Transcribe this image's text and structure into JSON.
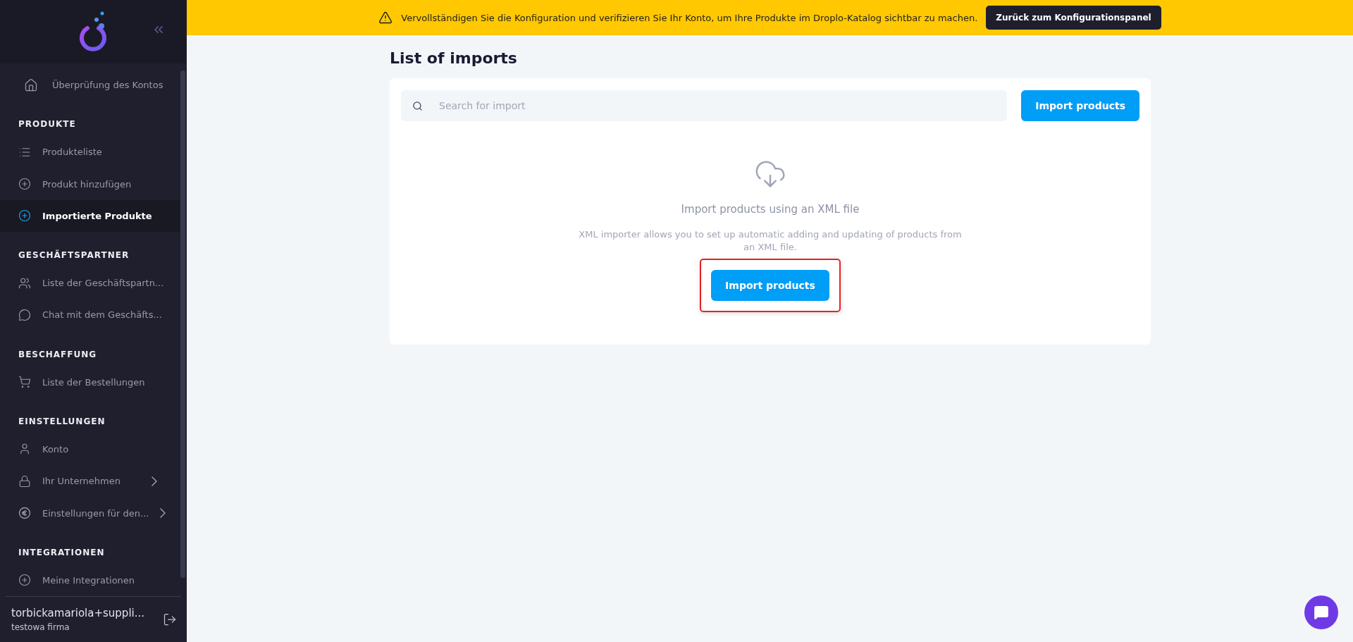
{
  "banner": {
    "message": "Vervollständigen Sie die Konfiguration und verifizieren Sie Ihr Konto, um Ihre Produkte im Droplo-Katalog sichtbar zu machen.",
    "button": "Zurück zum Konfigurationspanel"
  },
  "sidebar": {
    "top_item": {
      "label": "Überprüfung des Kontos",
      "selected": false
    },
    "sections": [
      {
        "title": "PRODUKTE",
        "items": [
          {
            "label": "Produkteliste",
            "selected": false,
            "submenu": false
          },
          {
            "label": "Produkt hinzufügen",
            "selected": false,
            "submenu": false
          },
          {
            "label": "Importierte Produkte",
            "selected": true,
            "submenu": false
          }
        ]
      },
      {
        "title": "GESCHÄFTSPARTNER",
        "items": [
          {
            "label": "Liste der Geschäftspartn...",
            "selected": false,
            "submenu": false
          },
          {
            "label": "Chat mit dem Geschäfts...",
            "selected": false,
            "submenu": false
          }
        ]
      },
      {
        "title": "BESCHAFFUNG",
        "items": [
          {
            "label": "Liste der Bestellungen",
            "selected": false,
            "submenu": false
          }
        ]
      },
      {
        "title": "EINSTELLUNGEN",
        "items": [
          {
            "label": "Konto",
            "selected": false,
            "submenu": false
          },
          {
            "label": "Ihr Unternehmen",
            "selected": false,
            "submenu": true
          },
          {
            "label": "Einstellungen für den...",
            "selected": false,
            "submenu": true
          }
        ]
      },
      {
        "title": "INTEGRATIONEN",
        "items": [
          {
            "label": "Meine Integrationen",
            "selected": false,
            "submenu": false
          }
        ]
      }
    ],
    "user": {
      "name": "torbickamariola+suppli...",
      "company": "testowa firma"
    }
  },
  "page": {
    "title": "List of imports",
    "search": {
      "placeholder": "Search for import"
    },
    "import_button": "Import products",
    "empty_state": {
      "heading": "Import products using an XML file",
      "description": "XML importer allows you to set up automatic adding and updating of products from an XML file.",
      "button": "Import products",
      "highlighted": true
    }
  }
}
